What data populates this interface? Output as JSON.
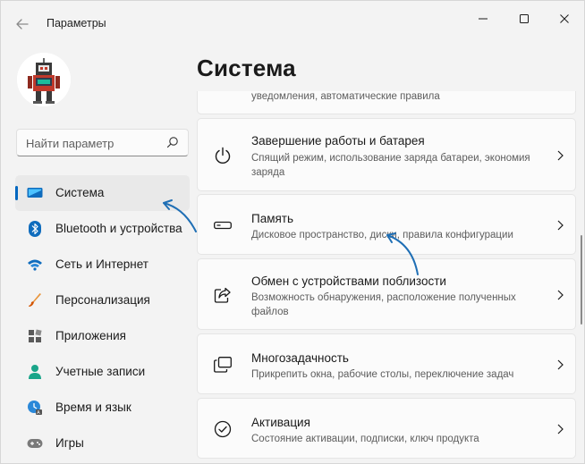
{
  "window": {
    "title": "Параметры"
  },
  "sidebar": {
    "search_placeholder": "Найти параметр",
    "items": [
      {
        "label": "Система",
        "icon": "system-icon",
        "active": true
      },
      {
        "label": "Bluetooth и устройства",
        "icon": "bluetooth-icon",
        "active": false
      },
      {
        "label": "Сеть и Интернет",
        "icon": "wifi-icon",
        "active": false
      },
      {
        "label": "Персонализация",
        "icon": "brush-icon",
        "active": false
      },
      {
        "label": "Приложения",
        "icon": "apps-icon",
        "active": false
      },
      {
        "label": "Учетные записи",
        "icon": "user-icon",
        "active": false
      },
      {
        "label": "Время и язык",
        "icon": "time-language-icon",
        "active": false
      },
      {
        "label": "Игры",
        "icon": "gamepad-icon",
        "active": false
      }
    ]
  },
  "main": {
    "title": "Система",
    "partial_card_text": "уведомления, автоматические правила",
    "cards": [
      {
        "title": "Завершение работы и батарея",
        "desc": "Спящий режим, использование заряда батареи, экономия заряда",
        "icon": "power-icon"
      },
      {
        "title": "Память",
        "desc": "Дисковое пространство, диски, правила конфигурации",
        "icon": "storage-icon"
      },
      {
        "title": "Обмен с устройствами поблизости",
        "desc": "Возможность обнаружения, расположение полученных файлов",
        "icon": "share-icon"
      },
      {
        "title": "Многозадачность",
        "desc": "Прикрепить окна, рабочие столы, переключение задач",
        "icon": "multitask-icon"
      },
      {
        "title": "Активация",
        "desc": "Состояние активации, подписки, ключ продукта",
        "icon": "activation-icon"
      }
    ]
  },
  "colors": {
    "accent": "#0067c0",
    "annotation_arrow": "#1f6fb5"
  }
}
